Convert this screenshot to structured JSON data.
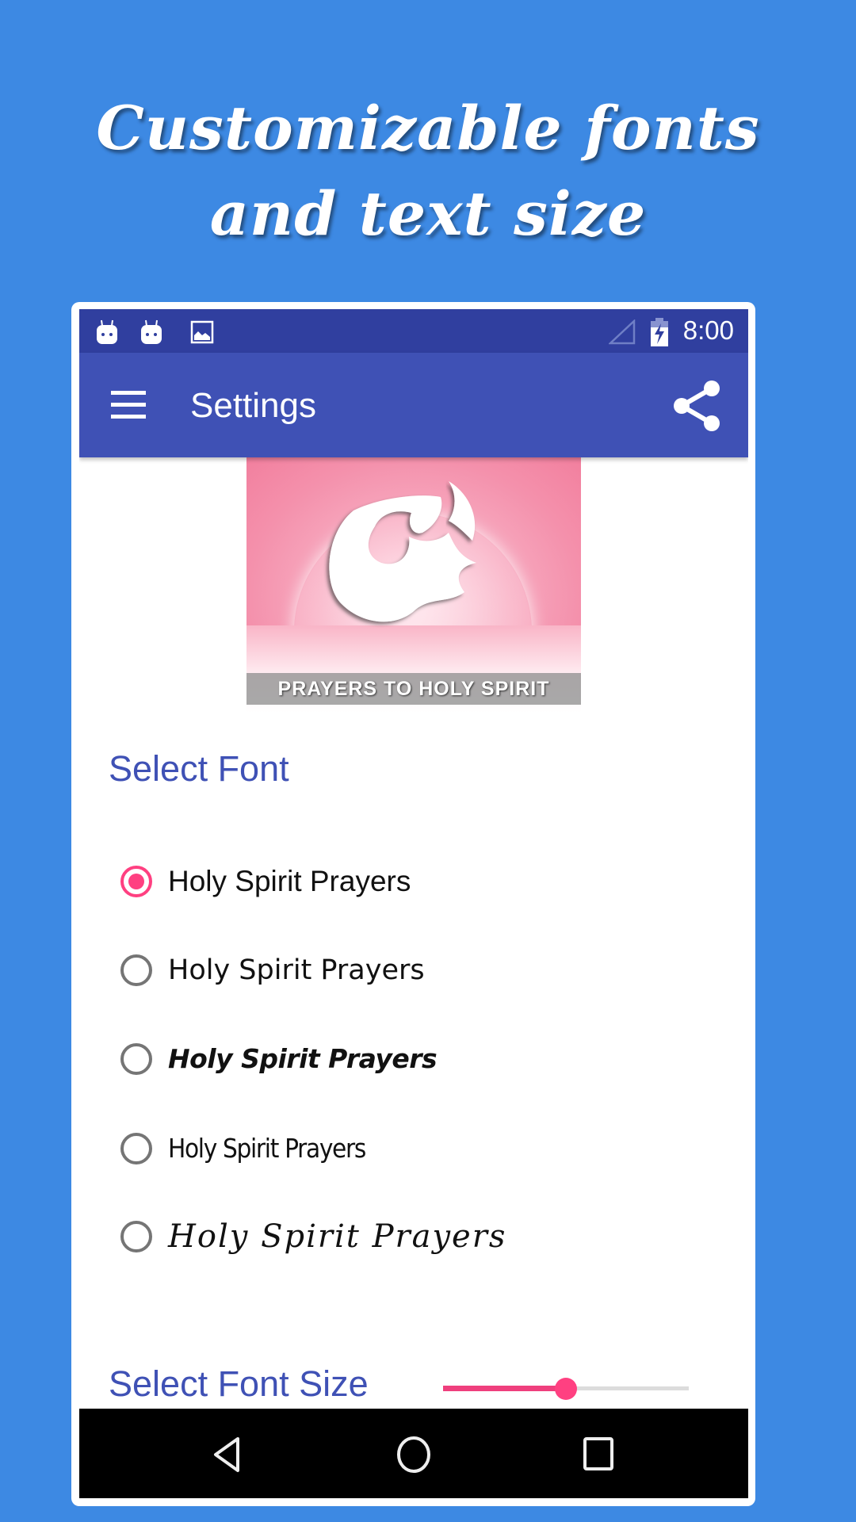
{
  "promo": {
    "headline_line1": "Customizable fonts",
    "headline_line2": "and text size"
  },
  "statusbar": {
    "left_icons": [
      "android-notification-icon",
      "android-notification-icon",
      "image-notification-icon"
    ],
    "right_icons": [
      "signal-icon",
      "battery-charging-icon"
    ],
    "time": "8:00"
  },
  "toolbar": {
    "menu_icon": "hamburger-menu-icon",
    "title": "Settings",
    "share_icon": "share-icon"
  },
  "banner": {
    "caption": "PRAYERS TO HOLY SPIRIT"
  },
  "font_section": {
    "title": "Select Font",
    "options": [
      {
        "label": "Holy Spirit Prayers",
        "selected": true
      },
      {
        "label": "Holy Spirit Prayers",
        "selected": false
      },
      {
        "label": "Holy Spirit Prayers",
        "selected": false
      },
      {
        "label": "Holy Spirit Prayers",
        "selected": false
      },
      {
        "label": "Holy Spirit Prayers",
        "selected": false
      }
    ]
  },
  "font_size_section": {
    "title": "Select Font Size",
    "slider_value_fraction": 0.5
  },
  "colors": {
    "background": "#3d89e3",
    "status_bar": "#303f9f",
    "primary": "#3f51b5",
    "accent": "#ff4081"
  },
  "navbar": {
    "back_icon": "back-triangle-icon",
    "home_icon": "home-circle-icon",
    "recents_icon": "recents-square-icon"
  }
}
